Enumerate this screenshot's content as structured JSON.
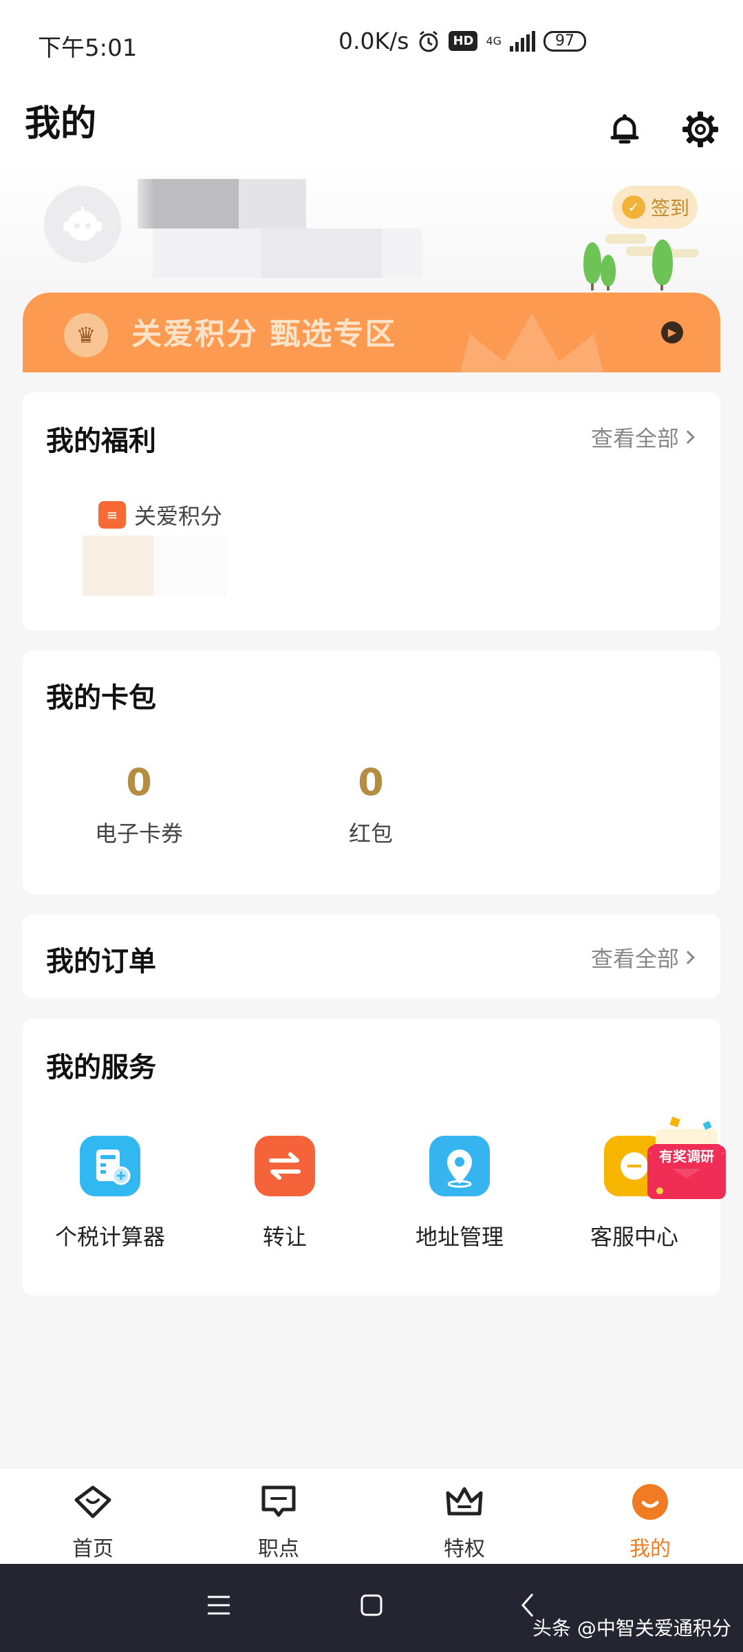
{
  "status_bar": {
    "time": "下午5:01",
    "speed": "0.0K/s",
    "hd": "HD",
    "network": "4G",
    "battery": "97"
  },
  "header": {
    "title": "我的"
  },
  "profile": {
    "checkin_label": "签到"
  },
  "banner": {
    "text": "关爱积分 甄选专区"
  },
  "welfare": {
    "title": "我的福利",
    "view_all": "查看全部",
    "points_label": "关爱积分"
  },
  "wallet": {
    "title": "我的卡包",
    "items": [
      {
        "value": "0",
        "label": "电子卡券"
      },
      {
        "value": "0",
        "label": "红包"
      }
    ]
  },
  "orders": {
    "title": "我的订单",
    "view_all": "查看全部"
  },
  "services": {
    "title": "我的服务",
    "items": [
      {
        "label": "个税计算器",
        "icon": "tax-calculator-icon",
        "color": "#32b8f0"
      },
      {
        "label": "转让",
        "icon": "transfer-icon",
        "color": "#f5633b"
      },
      {
        "label": "地址管理",
        "icon": "location-pin-icon",
        "color": "#35b4f0"
      },
      {
        "label": "客服中心",
        "icon": "customer-service-icon",
        "color": "#f7b500"
      }
    ]
  },
  "survey": {
    "label": "有奖调研"
  },
  "tabbar": {
    "tabs": [
      {
        "label": "首页",
        "icon": "home-icon",
        "active": false
      },
      {
        "label": "职点",
        "icon": "message-box-icon",
        "active": false
      },
      {
        "label": "特权",
        "icon": "crown-icon",
        "active": false
      },
      {
        "label": "我的",
        "icon": "profile-icon",
        "active": true
      }
    ]
  },
  "watermark": "头条 @中智关爱通积分",
  "colors": {
    "accent": "#f07b23",
    "banner": "#fd9a52",
    "gold": "#b48d42"
  }
}
